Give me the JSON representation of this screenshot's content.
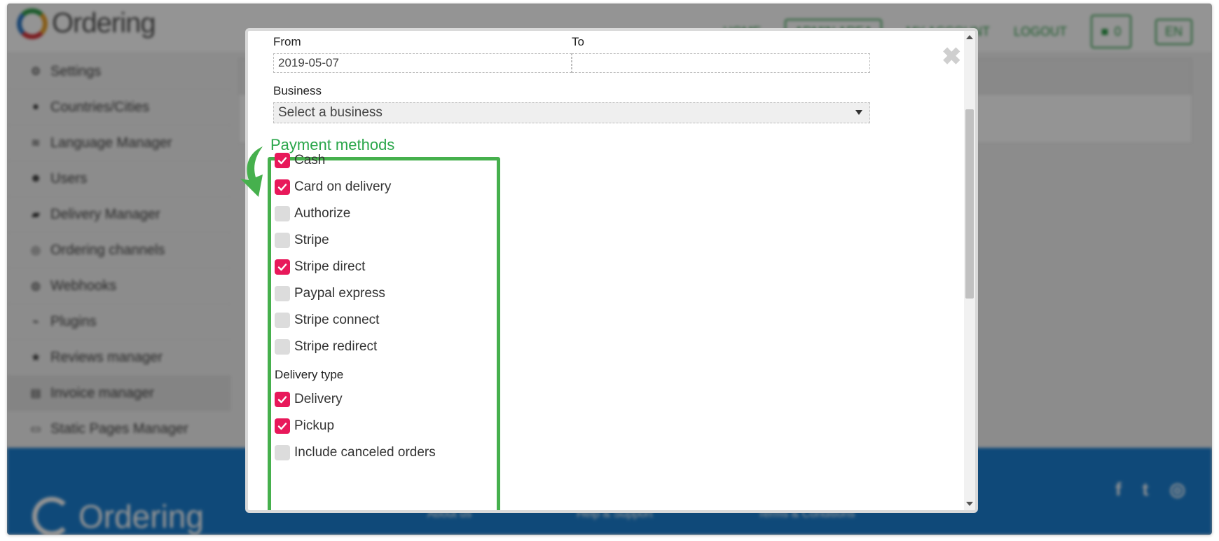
{
  "background": {
    "app_name": "Ordering",
    "nav": {
      "home": "HOME",
      "admin_area": "ADMIN AREA",
      "my_account": "MY ACCOUNT",
      "logout": "LOGOUT",
      "cart_count": "0",
      "language": "EN"
    },
    "sidebar": [
      {
        "label": "Settings",
        "icon": "gear-icon"
      },
      {
        "label": "Countries/Cities",
        "icon": "map-pin-icon"
      },
      {
        "label": "Language Manager",
        "icon": "language-icon"
      },
      {
        "label": "Users",
        "icon": "users-icon"
      },
      {
        "label": "Delivery Manager",
        "icon": "car-icon"
      },
      {
        "label": "Ordering channels",
        "icon": "channels-icon"
      },
      {
        "label": "Webhooks",
        "icon": "globe-icon"
      },
      {
        "label": "Plugins",
        "icon": "plug-icon"
      },
      {
        "label": "Reviews manager",
        "icon": "star-icon"
      },
      {
        "label": "Invoice manager",
        "icon": "file-icon"
      },
      {
        "label": "Static Pages Manager",
        "icon": "window-icon"
      }
    ],
    "active_sidebar_index": 9,
    "footer": {
      "brand": "Ordering",
      "links": [
        "About us",
        "Help & Support",
        "Terms & Conditions"
      ]
    }
  },
  "modal": {
    "from_label": "From",
    "to_label": "To",
    "from_value": "2019-05-07",
    "to_value": "",
    "business_label": "Business",
    "business_placeholder": "Select a business",
    "annotation": "Payment methods",
    "payment_methods": [
      {
        "label": "Cash",
        "checked": true
      },
      {
        "label": "Card on delivery",
        "checked": true
      },
      {
        "label": "Authorize",
        "checked": false
      },
      {
        "label": "Stripe",
        "checked": false
      },
      {
        "label": "Stripe direct",
        "checked": true
      },
      {
        "label": "Paypal express",
        "checked": false
      },
      {
        "label": "Stripe connect",
        "checked": false
      },
      {
        "label": "Stripe redirect",
        "checked": false
      }
    ],
    "delivery_type_label": "Delivery type",
    "delivery_types": [
      {
        "label": "Delivery",
        "checked": true
      },
      {
        "label": "Pickup",
        "checked": true
      },
      {
        "label": "Include canceled orders",
        "checked": false
      }
    ]
  },
  "colors": {
    "brand_green": "#2f9d4a",
    "checkbox_on": "#e8185a",
    "annotation_green": "#46b04d",
    "footer_blue": "#1b7fd1"
  }
}
